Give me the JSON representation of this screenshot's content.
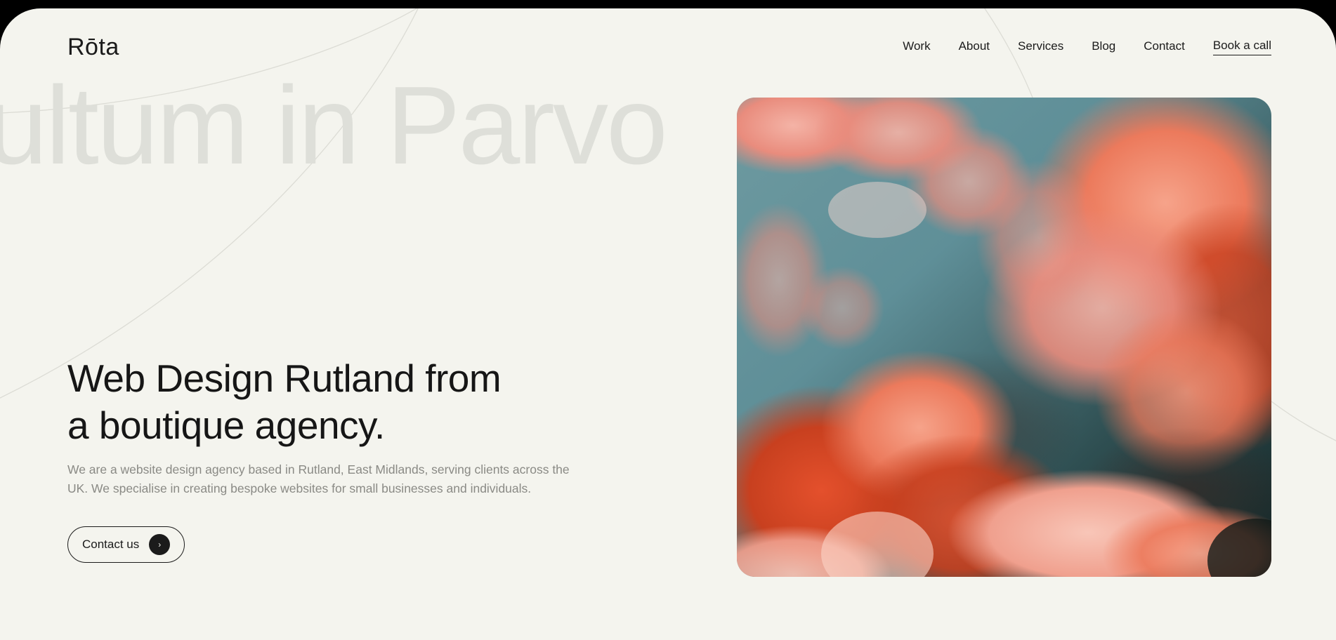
{
  "brand": {
    "logo_text": "Rōta"
  },
  "nav": {
    "items": [
      {
        "label": "Work"
      },
      {
        "label": "About"
      },
      {
        "label": "Services"
      },
      {
        "label": "Blog"
      },
      {
        "label": "Contact"
      }
    ],
    "cta_label": "Book a call"
  },
  "hero": {
    "background_word": "ultum in Parvo",
    "title_line1": "Web Design Rutland from",
    "title_line2": "a boutique agency.",
    "description_line1": "We are a website design agency based in Rutland, East Midlands, serving clients across the",
    "description_line2": "UK. We specialise in creating bespoke websites for small businesses and individuals.",
    "contact_button_label": "Contact us",
    "contact_button_icon": "arrow-right-icon",
    "image_subject": "pink-clouds-sky-image"
  },
  "colors": {
    "background": "#f4f4ee",
    "text": "#1b1b1b",
    "muted_text": "#8a8a85",
    "watermark": "#dedfd9"
  }
}
